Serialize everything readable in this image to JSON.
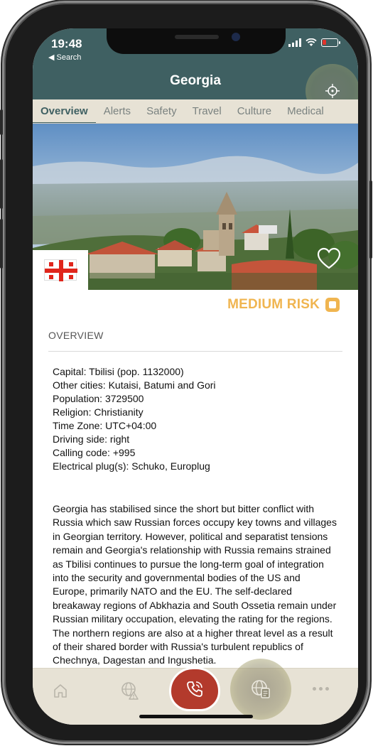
{
  "status_bar": {
    "time": "19:48",
    "back_label": "◀ Search"
  },
  "header": {
    "title": "Georgia"
  },
  "tabs": [
    {
      "label": "Overview",
      "active": true
    },
    {
      "label": "Alerts",
      "active": false
    },
    {
      "label": "Safety",
      "active": false
    },
    {
      "label": "Travel",
      "active": false
    },
    {
      "label": "Culture",
      "active": false
    },
    {
      "label": "Medical",
      "active": false
    }
  ],
  "risk": {
    "label": "MEDIUM RISK",
    "color": "#f0b550"
  },
  "overview": {
    "section_title": "OVERVIEW",
    "facts": [
      "Capital: Tbilisi (pop. 1132000)",
      "Other cities: Kutaisi, Batumi and Gori",
      "Population: 3729500",
      "Religion: Christianity",
      "Time Zone: UTC+04:00",
      "Driving side: right",
      "Calling code: +995",
      "Electrical plug(s): Schuko, Europlug"
    ],
    "description": "Georgia has stabilised since the short but bitter conflict with Russia which saw Russian forces occupy key towns and villages in Georgian territory. However, political and separatist tensions remain and Georgia's relationship with Russia remains strained as Tbilisi continues to pursue the long-term goal of integration into the security and governmental bodies of the US and Europe, primarily NATO and the EU. The self-declared breakaway regions of Abkhazia and South Ossetia remain under Russian military occupation, elevating the rating for the regions. The northern regions are also at a higher threat level as a result of their shared border with Russia's turbulent republics of Chechnya, Dagestan and Ingushetia."
  },
  "colors": {
    "header_bg": "#3f6062",
    "tab_bar_bg": "#e7e2d5",
    "call_button": "#b33a2c"
  }
}
